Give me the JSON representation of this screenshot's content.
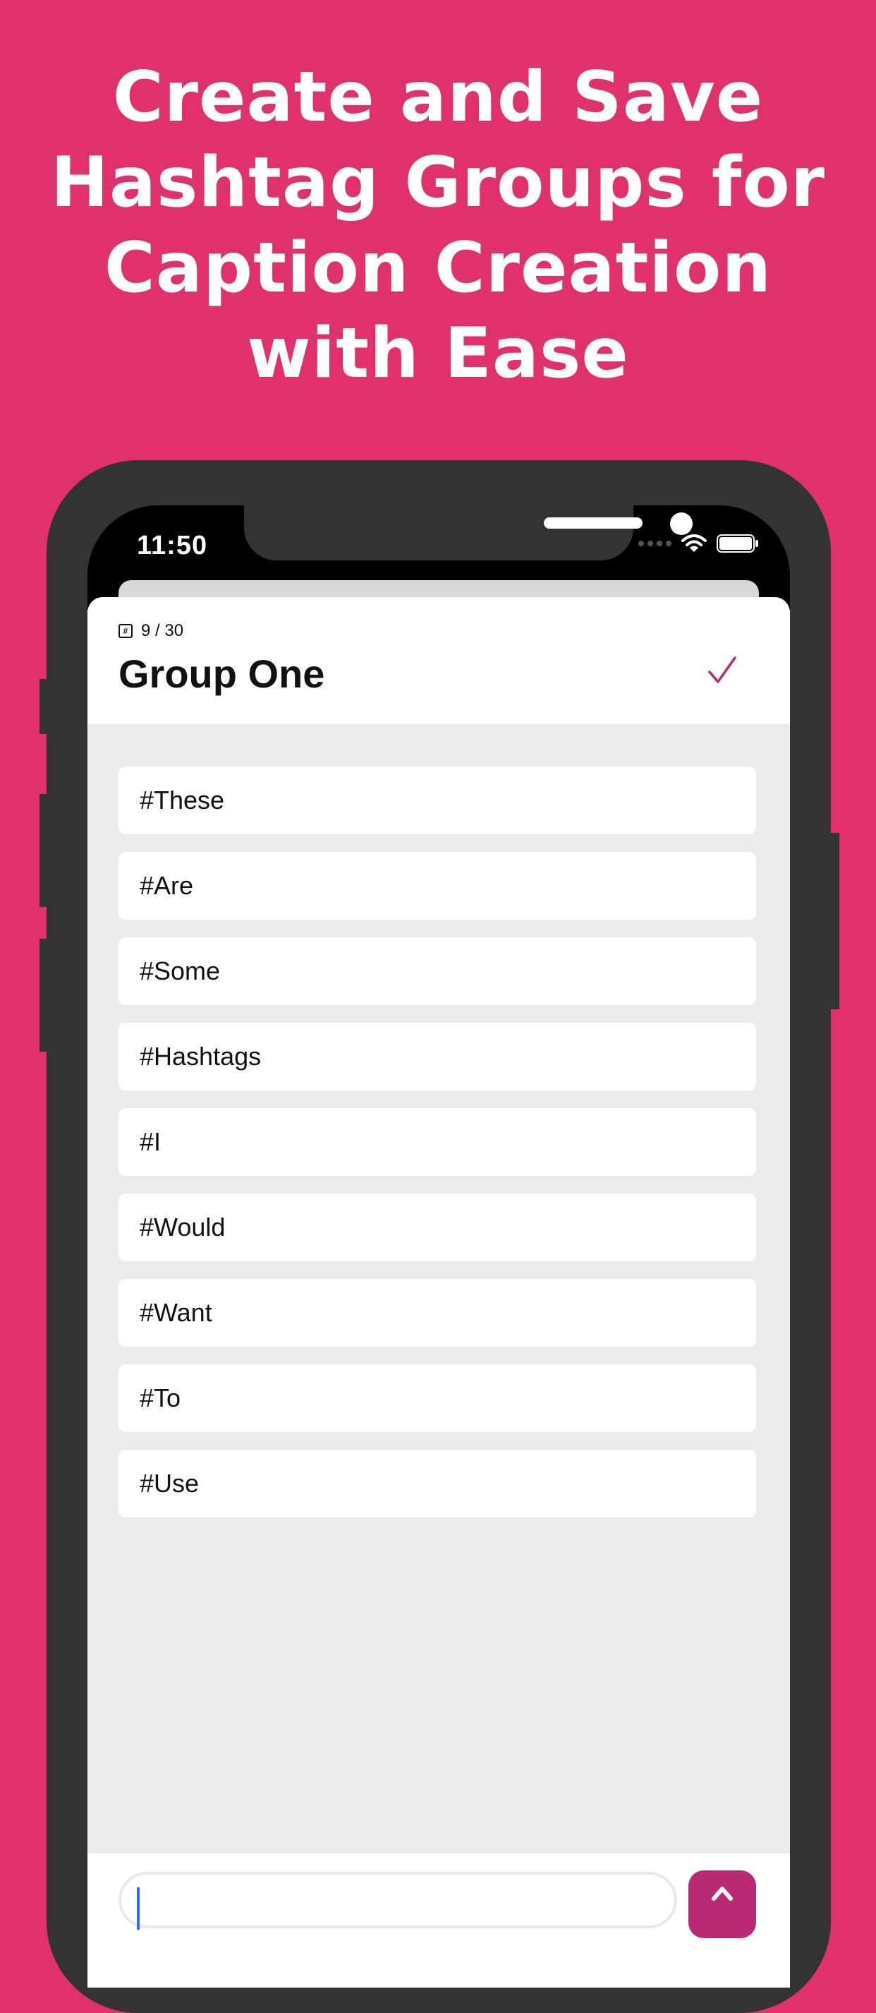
{
  "headline": {
    "lines": [
      "Create and Save",
      "Hashtag Groups for",
      "Caption Creation",
      "with Ease"
    ]
  },
  "status_bar": {
    "time": "11:50"
  },
  "group": {
    "count": "9 / 30",
    "title": "Group One"
  },
  "hashtags": [
    "#These",
    "#Are",
    "#Some",
    "#Hashtags",
    "#I",
    "#Would",
    "#Want",
    "#To",
    "#Use"
  ],
  "colors": {
    "background": "#e0316d",
    "accent": "#b92a74",
    "phone_frame": "#333333",
    "list_background": "#ececec"
  },
  "icons": {
    "check": "check-icon",
    "hash": "hash-icon",
    "send": "send-arrow-icon",
    "wifi": "wifi-icon",
    "battery": "battery-icon"
  }
}
